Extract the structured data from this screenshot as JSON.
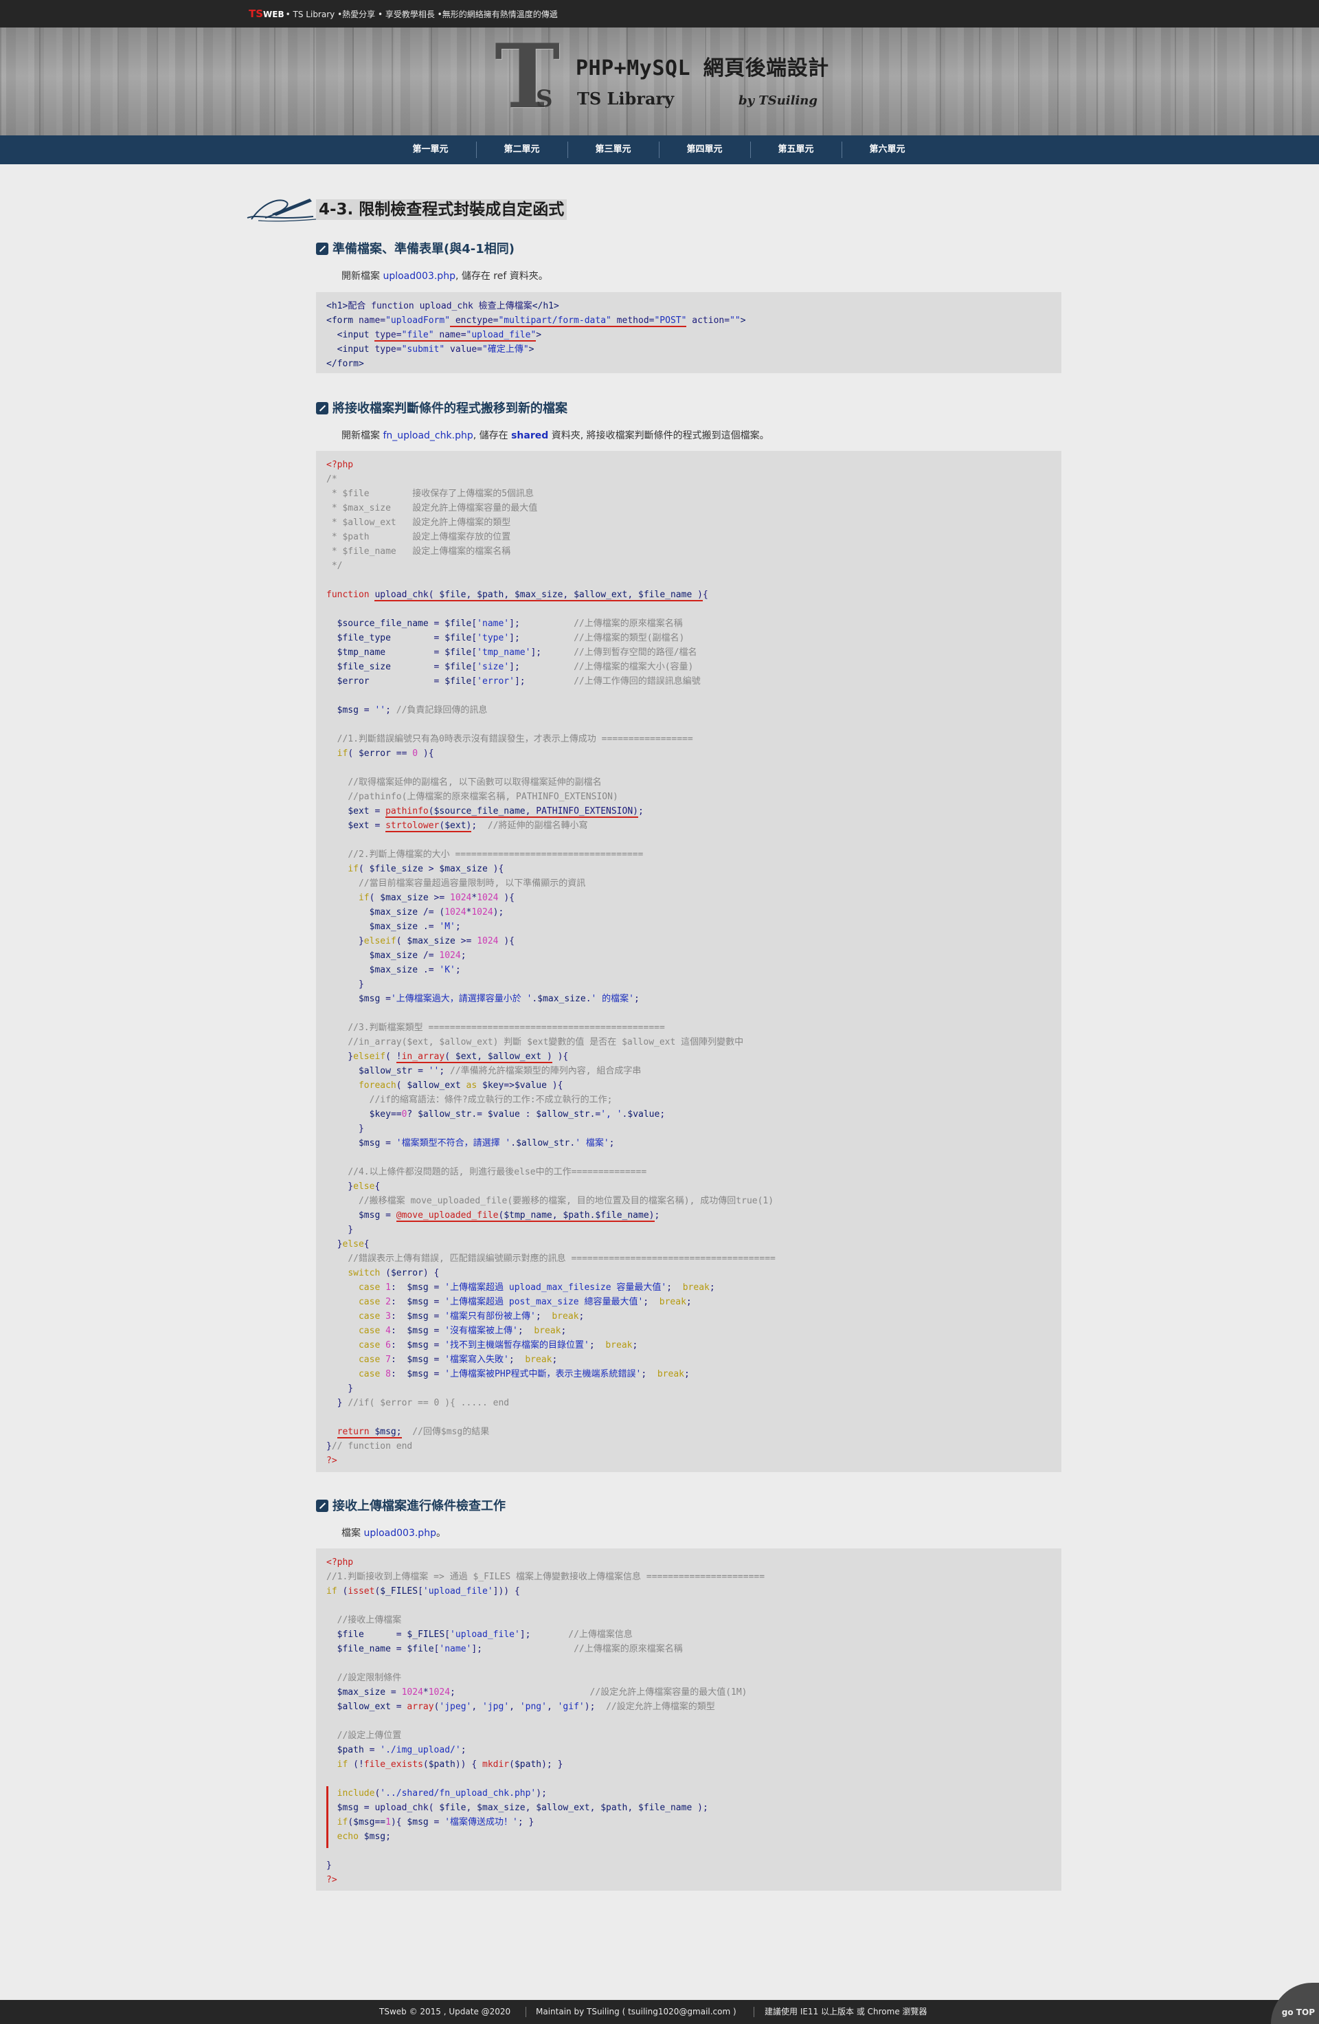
{
  "topbar": {
    "ts_mark": "TS",
    "web_mark": "WEB",
    "text": "• TS Library •熱愛分享 • 享受教學相長 •無形的網絡擁有熱情溫度的傳遞"
  },
  "banner": {
    "logo_letter": "T",
    "logo_letter_small": "S",
    "title": "PHP+MySQL 網頁後端設計",
    "subtitle": "TS Library",
    "by": "by TSuiling"
  },
  "nav": {
    "items": [
      "第一單元",
      "第二單元",
      "第三單元",
      "第四單元",
      "第五單元",
      "第六單元"
    ]
  },
  "page_title": "4-3. 限制檢查程式封裝成自定函式",
  "sections": [
    {
      "heading": "準備檔案、準備表單(與4-1相同)",
      "intro_pre": "開新檔案 ",
      "intro_file": "upload003.php",
      "intro_post": ", 儲存在 ref 資料夾。"
    },
    {
      "heading": "將接收檔案判斷條件的程式搬移到新的檔案",
      "intro_pre": "開新檔案 ",
      "intro_file": "fn_upload_chk.php",
      "intro_mid": ", 儲存在 ",
      "intro_dir": "shared",
      "intro_post": " 資料夾, 將接收檔案判斷條件的程式搬到這個檔案。"
    },
    {
      "heading": "接收上傳檔案進行條件檢查工作",
      "intro_pre": "檔案 ",
      "intro_file": "upload003.php",
      "intro_post": "。"
    }
  ],
  "footer": {
    "copyright": "TSweb © 2015 , Update @2020",
    "maintain": "Maintain by TSuiling ( tsuiling1020@gmail.com )",
    "browser": "建議使用 IE11 以上版本 或 Chrome 瀏覽器",
    "gotop": "go TOP"
  }
}
